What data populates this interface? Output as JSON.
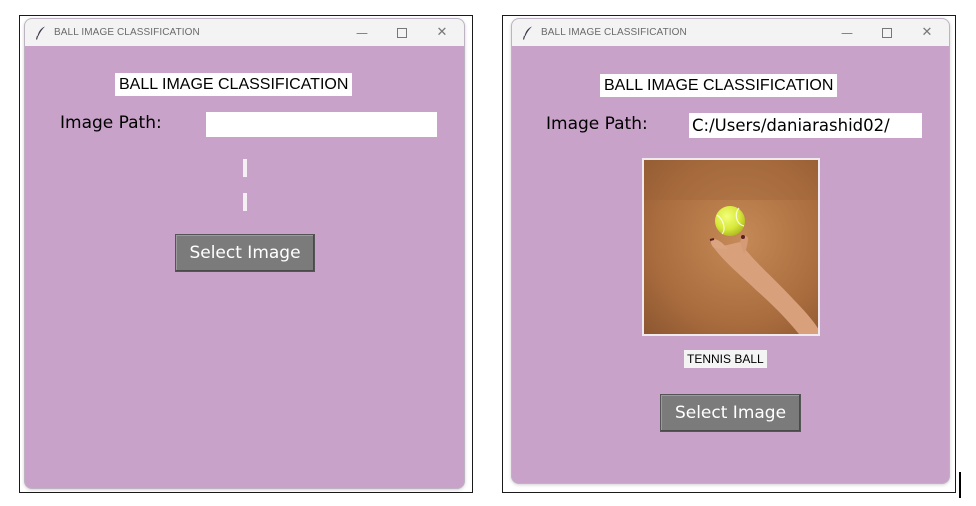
{
  "left_window": {
    "title": "BALL IMAGE CLASSIFICATION",
    "heading": "BALL IMAGE CLASSIFICATION",
    "path_label": "Image Path:",
    "path_value": "",
    "select_button": "Select Image"
  },
  "right_window": {
    "title": "BALL IMAGE CLASSIFICATION",
    "heading": "BALL IMAGE CLASSIFICATION",
    "path_label": "Image Path:",
    "path_value": "C:/Users/daniarashid02/",
    "image": "tennis-ball-toss-photo",
    "result": "TENNIS BALL",
    "select_button": "Select Image"
  },
  "window_controls": {
    "minimize": "—",
    "close": "✕"
  },
  "colors": {
    "window_bg": "#c8a2c8",
    "titlebar_bg": "#f3f3f3",
    "button_bg": "#7b7b7b"
  }
}
